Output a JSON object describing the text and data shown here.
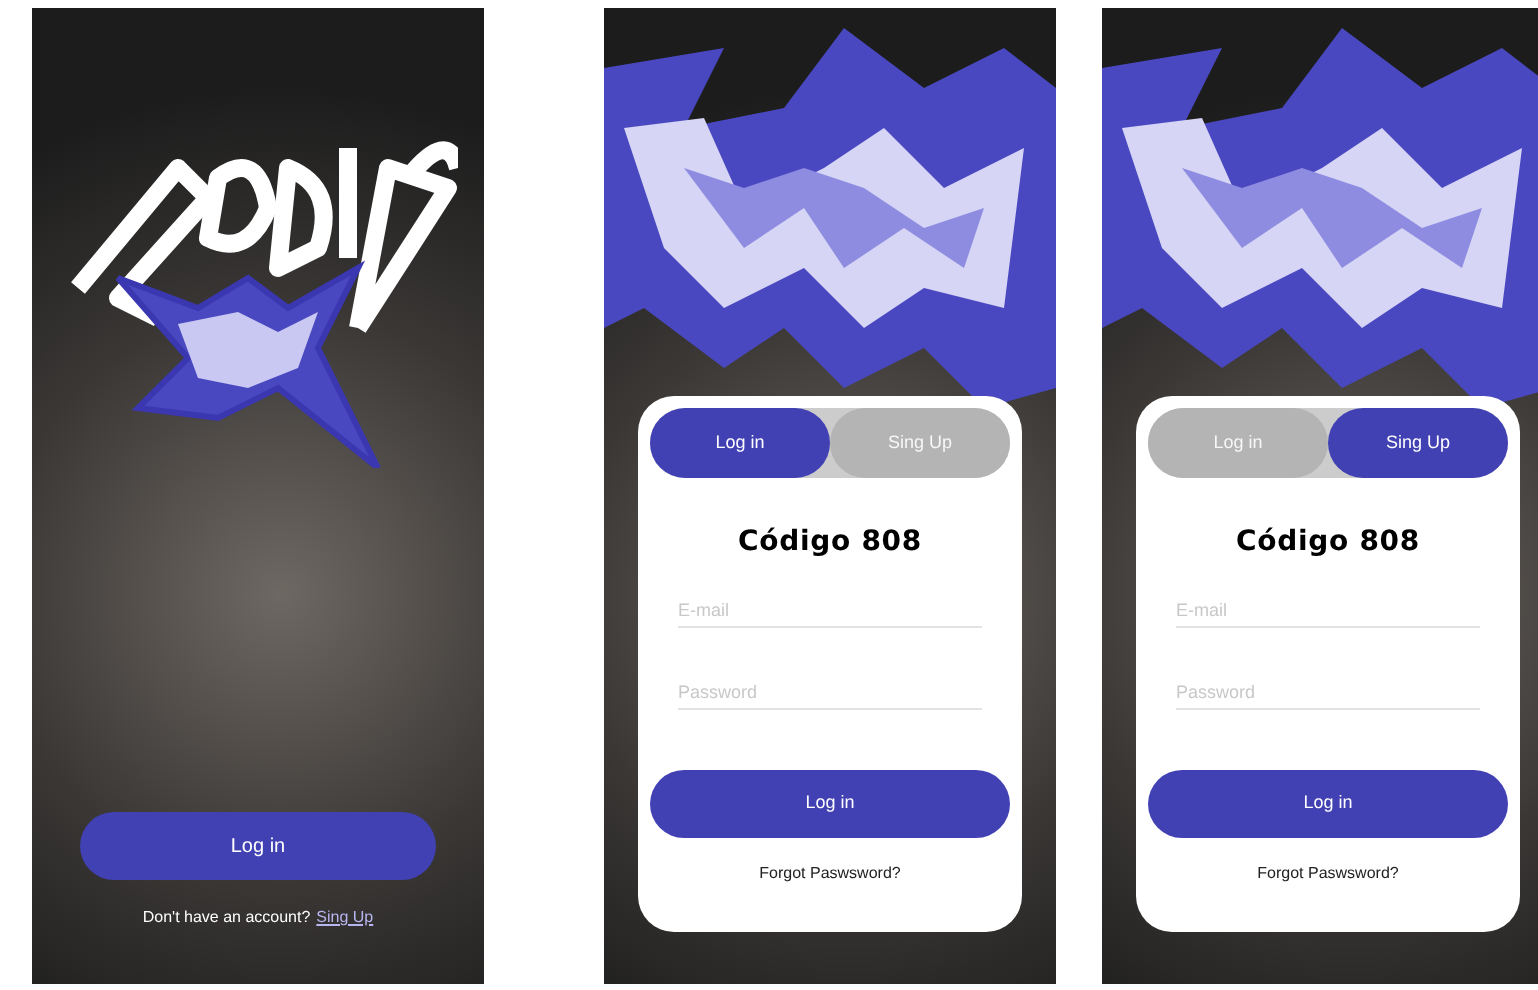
{
  "screens": [
    {
      "kind": "welcome",
      "button": "Log in",
      "prompt": "Don't have an account?",
      "link": "Sing Up"
    },
    {
      "kind": "auth",
      "tabs": [
        {
          "label": "Log in",
          "selected": true
        },
        {
          "label": "Sing Up",
          "selected": false
        }
      ],
      "title": "Código 808",
      "fields": [
        {
          "placeholder": "E-mail"
        },
        {
          "placeholder": "Password"
        }
      ],
      "button": "Log in",
      "link": "Forgot Paswsword?"
    },
    {
      "kind": "auth",
      "tabs": [
        {
          "label": "Log in",
          "selected": false
        },
        {
          "label": "Sing Up",
          "selected": true
        }
      ],
      "title": "Código 808",
      "fields": [
        {
          "placeholder": "E-mail"
        },
        {
          "placeholder": "Password"
        }
      ],
      "button": "Log in",
      "link": "Forgot Paswsword?"
    }
  ]
}
